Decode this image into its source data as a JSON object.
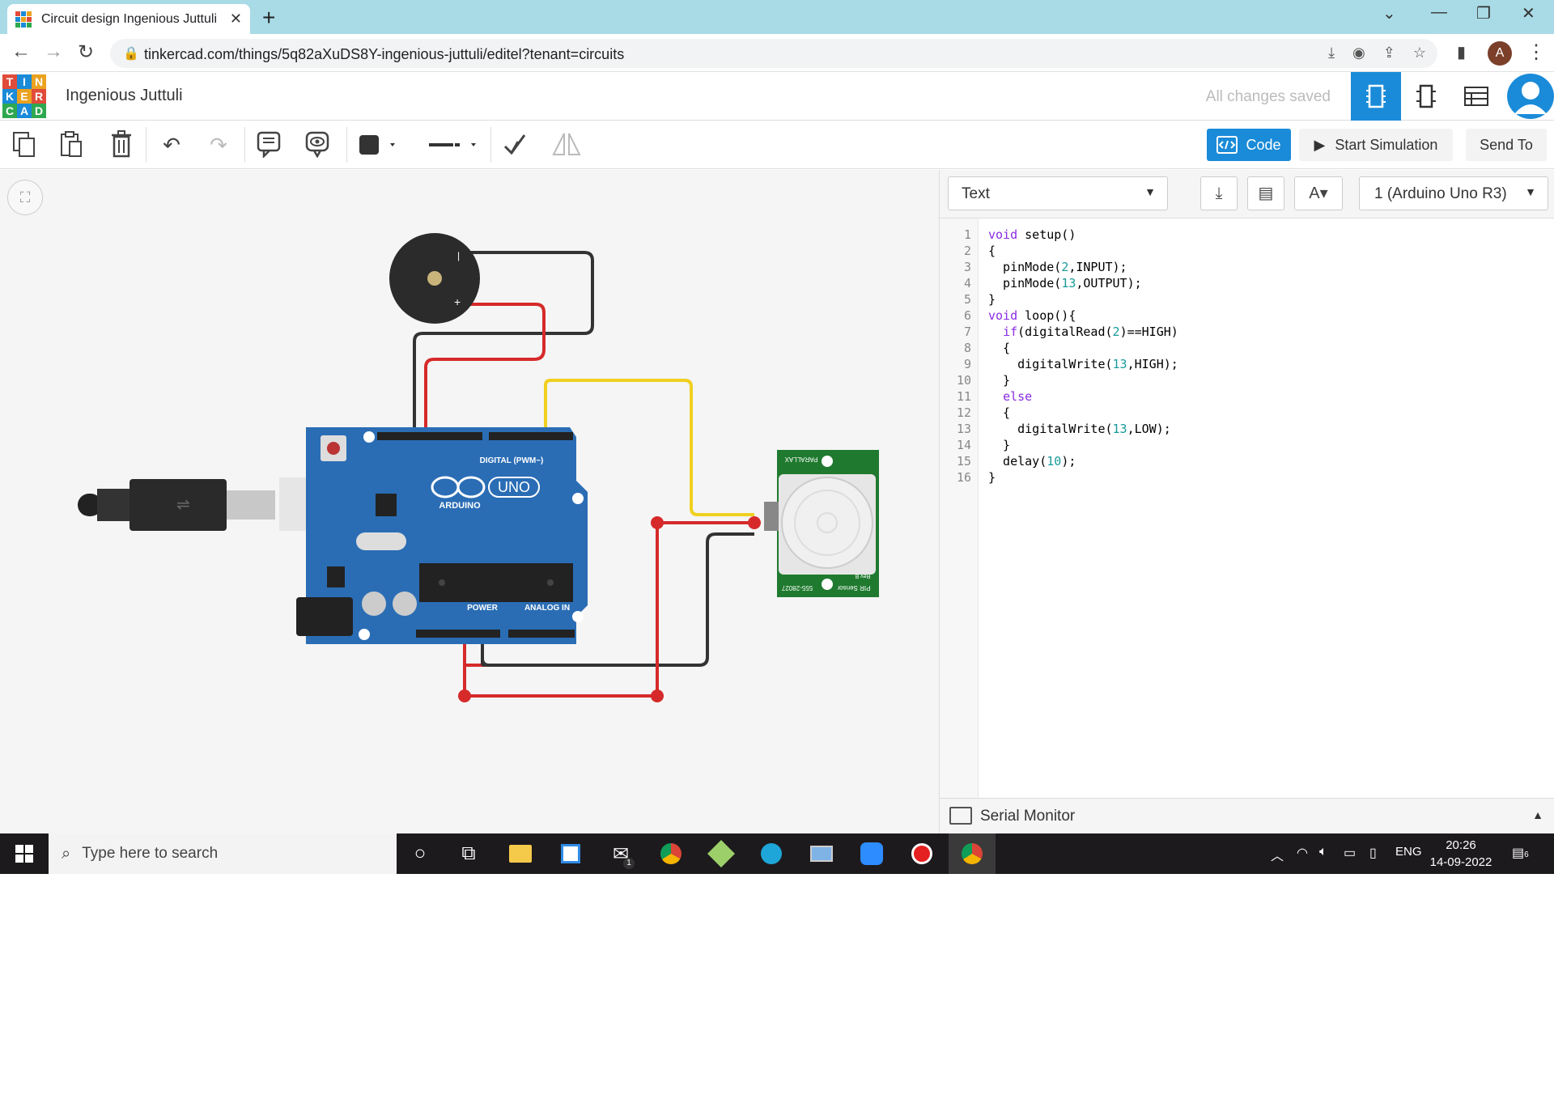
{
  "browser": {
    "tab_title": "Circuit design Ingenious Juttuli |",
    "url": "tinkercad.com/things/5q82aXuDS8Y-ingenious-juttuli/editel?tenant=circuits",
    "profile_initial": "A"
  },
  "app": {
    "logo_letters": [
      "T",
      "I",
      "N",
      "K",
      "E",
      "R",
      "C",
      "A",
      "D"
    ],
    "logo_colors": [
      "#e04b3a",
      "#1a8bd8",
      "#eaa21f",
      "#1a8bd8",
      "#eaa21f",
      "#e04b3a",
      "#2ea84f",
      "#1a8bd8",
      "#2ea84f"
    ],
    "design_name": "Ingenious Juttuli",
    "save_status": "All changes saved"
  },
  "toolbar": {
    "code_label": "Code",
    "start_sim_label": "Start Simulation",
    "send_to_label": "Send To"
  },
  "code_panel": {
    "mode": "Text",
    "board": "1 (Arduino Uno R3)",
    "serial_monitor_label": "Serial Monitor",
    "lines": [
      "void setup()",
      "{",
      "  pinMode(2,INPUT);",
      "  pinMode(13,OUTPUT);",
      "}",
      "void loop(){",
      "  if(digitalRead(2)==HIGH)",
      "  {",
      "    digitalWrite(13,HIGH);",
      "  }",
      "  else",
      "  {",
      "    digitalWrite(13,LOW);",
      "  }",
      "  delay(10);",
      "}"
    ],
    "line_numbers": [
      "1",
      "2",
      "3",
      "4",
      "5",
      "6",
      "7",
      "8",
      "9",
      "10",
      "11",
      "12",
      "13",
      "14",
      "15",
      "16"
    ]
  },
  "circuit": {
    "arduino_model": "UNO",
    "arduino_brand": "ARDUINO",
    "digital_label": "DIGITAL (PWM~)",
    "power_label": "POWER",
    "analog_label": "ANALOG IN",
    "pir_brand": "PARALLAX",
    "pir_part": "555-28027",
    "pir_label": "PIR Sensor",
    "pir_rev": "Rev B",
    "colors": {
      "board": "#2a6db5",
      "pir_board": "#1f7a2f",
      "wire_red": "#d62a2a",
      "wire_black": "#333333",
      "wire_yellow": "#f0d020"
    }
  },
  "taskbar": {
    "search_placeholder": "Type here to search",
    "mail_badge": "1",
    "lang": "ENG",
    "time": "20:26",
    "date": "14-09-2022",
    "notif_count": "6"
  }
}
